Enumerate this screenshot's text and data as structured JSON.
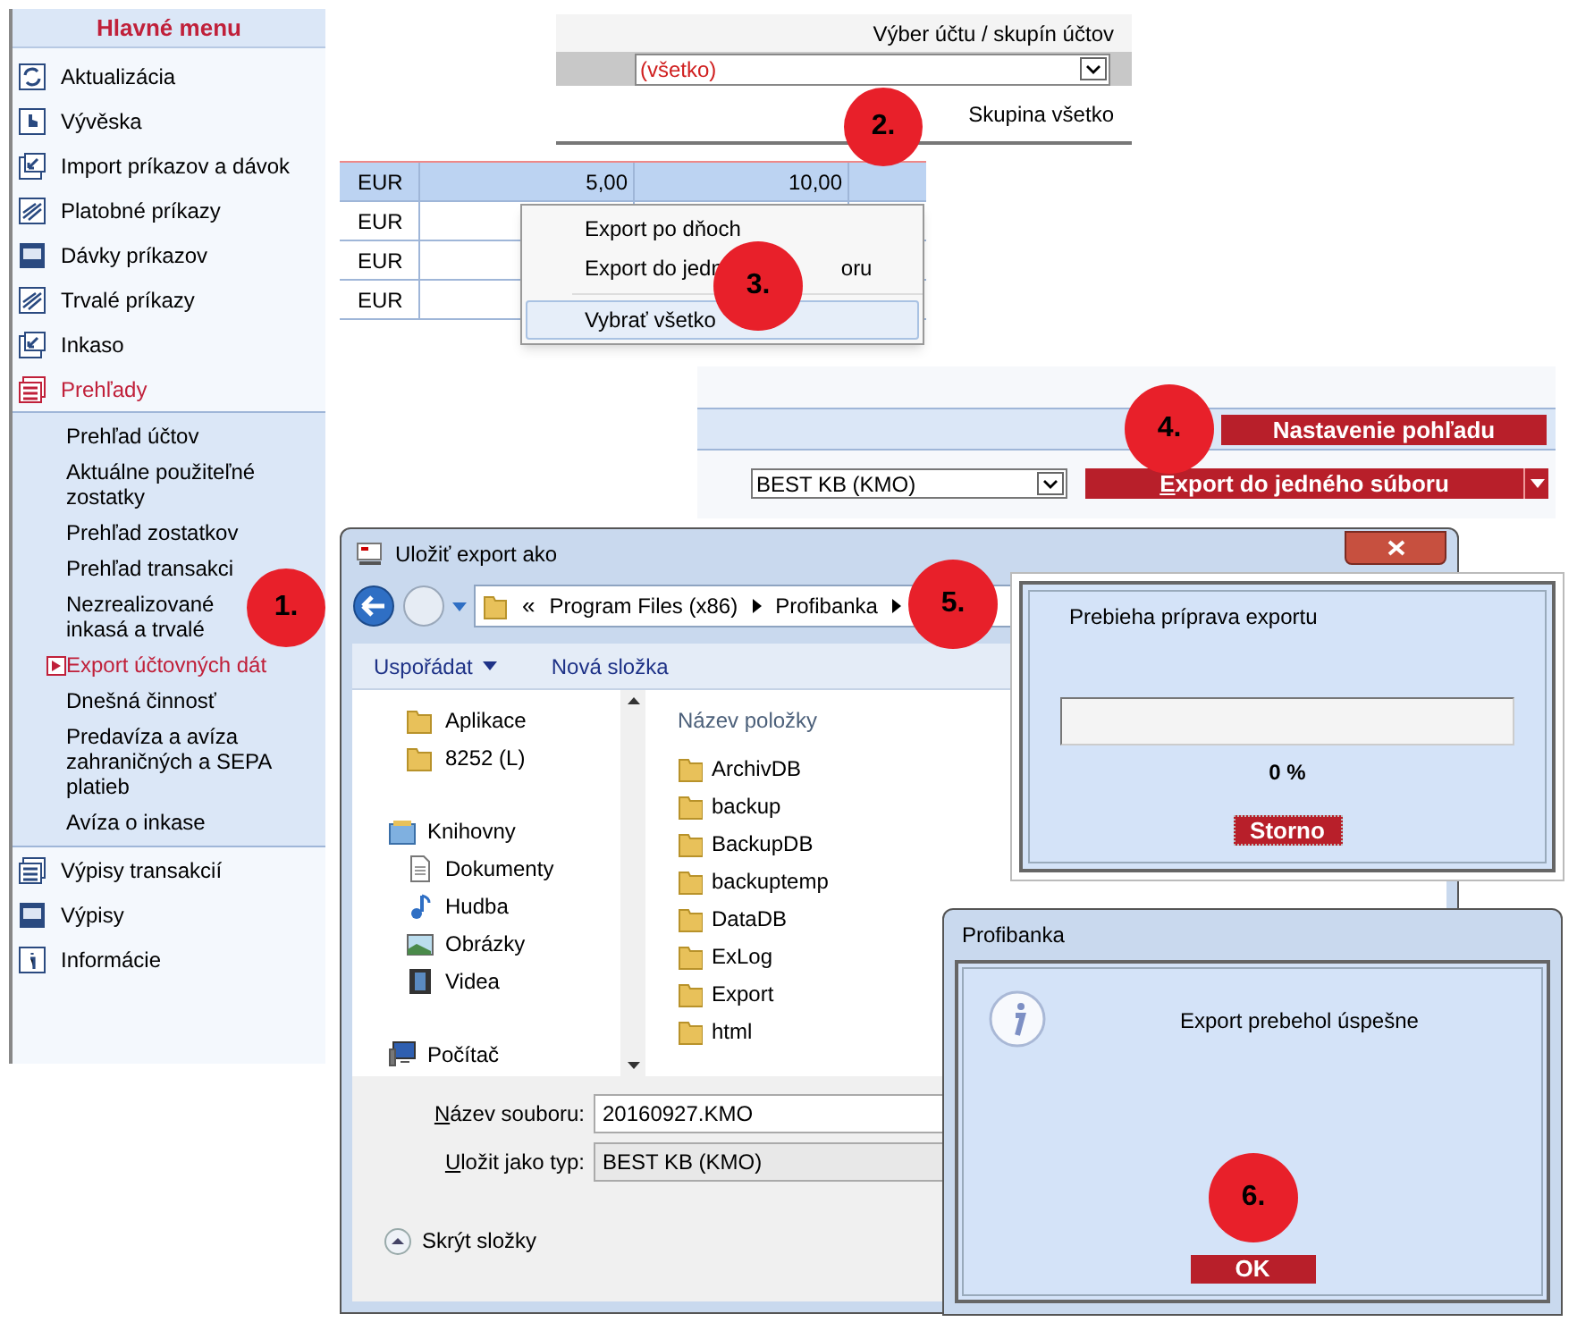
{
  "main_menu": {
    "title": "Hlavné menu",
    "items": [
      {
        "label": "Aktualizácia",
        "selected": false
      },
      {
        "label": "Vývěska",
        "selected": false
      },
      {
        "label": "Import príkazov a dávok",
        "selected": false
      },
      {
        "label": "Platobné príkazy",
        "selected": false
      },
      {
        "label": "Dávky príkazov",
        "selected": false
      },
      {
        "label": "Trvalé príkazy",
        "selected": false
      },
      {
        "label": "Inkaso",
        "selected": false
      },
      {
        "label": "Prehľady",
        "selected": true,
        "children": [
          {
            "label": "Prehľad účtov",
            "selected": false
          },
          {
            "label": "Aktuálne použiteľné zostatky",
            "selected": false
          },
          {
            "label": "Prehľad zostatkov",
            "selected": false
          },
          {
            "label": "Prehľad transakci",
            "selected": false
          },
          {
            "label": "Nezrealizované inkasá a trvalé",
            "selected": false
          },
          {
            "label": "Export účtovných dát",
            "selected": true
          },
          {
            "label": "Dnešná činnosť",
            "selected": false
          },
          {
            "label": "Predavíza a avíza zahraničných a SEPA platieb",
            "selected": false
          },
          {
            "label": "Avíza o inkase",
            "selected": false
          }
        ]
      },
      {
        "label": "Výpisy transakcií",
        "selected": false
      },
      {
        "label": "Výpisy",
        "selected": false
      },
      {
        "label": "Informácie",
        "selected": false
      }
    ]
  },
  "account_selector": {
    "label": "Výber účtu / skupín účtov",
    "value": "(všetko)",
    "group": "Skupina všetko"
  },
  "account_table": {
    "rows": [
      {
        "currency": "EUR",
        "column_2": "5,00",
        "column_3": "10,00",
        "selected": true
      },
      {
        "currency": "EUR",
        "selected": false
      },
      {
        "currency": "EUR",
        "selected": false
      },
      {
        "currency": "EUR",
        "selected": false
      }
    ]
  },
  "context_menu": {
    "items": [
      {
        "label": "Export po dňoch",
        "selected": false
      },
      {
        "label": "Export do jedn",
        "label_tail": "oru",
        "selected": false
      },
      {
        "label": "Vybrať všetko",
        "selected": true
      }
    ]
  },
  "view_panel": {
    "settings_button": "Nastavenie pohľadu",
    "format_select": "BEST KB (KMO)",
    "export_button": "Export do jedného súboru"
  },
  "save_dialog": {
    "title": "Uložiť export ako",
    "path_prefix": "«",
    "path": [
      "Program Files (x86)",
      "Profibanka"
    ],
    "toolbar": [
      "Uspořádat",
      "Nová složka"
    ],
    "nav": [
      {
        "children": [
          {
            "label": "Aplikace",
            "kind": "folder"
          },
          {
            "label": "8252 (L)",
            "kind": "folder"
          }
        ]
      },
      {
        "label": "Knihovny",
        "kind": "library",
        "children": [
          {
            "label": "Dokumenty",
            "kind": "document"
          },
          {
            "label": "Hudba",
            "kind": "music"
          },
          {
            "label": "Obrázky",
            "kind": "picture"
          },
          {
            "label": "Videa",
            "kind": "video"
          }
        ]
      },
      {
        "label": "Počítač",
        "kind": "computer"
      }
    ],
    "column": "Název položky",
    "files": [
      "ArchivDB",
      "backup",
      "BackupDB",
      "backuptemp",
      "DataDB",
      "ExLog",
      "Export",
      "html"
    ],
    "filename_label": "Název souboru:",
    "filename": "20160927.KMO",
    "type_label": "Uložit jako typ:",
    "type": "BEST KB (KMO)",
    "hide_folders": "Skrýt složky"
  },
  "progress_dialog": {
    "message": "Prebieha príprava exportu",
    "level": 0,
    "percent": "0 %",
    "cancel_button": "Storno"
  },
  "info_dialog": {
    "title": "Profibanka",
    "message": "Export prebehol úspešne",
    "ok_button": "OK"
  },
  "steps": [
    "1.",
    "2.",
    "3.",
    "4.",
    "5.",
    "6."
  ]
}
